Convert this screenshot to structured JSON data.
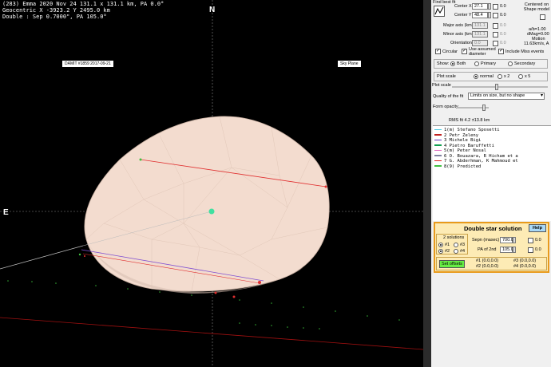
{
  "header": {
    "line1": "(283) Emma  2020 Nov 24  131.1 x 131.1 km, PA 0.0°",
    "line2": "Geocentric  X -3923.2  Y 2495.0 km",
    "line3": "Double : Sep 0.7000\", PA 105.0°"
  },
  "plot": {
    "model_tag": "DAMIT #1859 2017-09-21",
    "plane_tag": "Sky Plane",
    "north_label": "N",
    "east_label": "E"
  },
  "panel": {
    "find_best_fit": "Find best fit",
    "center_x_label": "Center X",
    "center_x_value": "27.1",
    "center_y_label": "Center Y",
    "center_y_value": "48.4",
    "centered_label": "Centered on Shape model",
    "major_axis_label": "Major axis (km)",
    "major_axis_value": "131.1",
    "minor_axis_label": "Minor axis (km)",
    "minor_axis_value": "131.1",
    "orientation_label": "Orientation",
    "orientation_value": "0.0",
    "ab_ratio": "a/b=1.00",
    "dmag": "dMag=0.00",
    "motion_label": "Motion",
    "motion_value": "11.63km/s, A",
    "zero_value": "0.0",
    "circular_label": "Circular",
    "use_assumed_label": "Use assumed diameter",
    "include_miss_label": "Include Miss events",
    "show_label": "Show:",
    "show_both": "Both",
    "show_primary": "Primary",
    "show_secondary": "Secondary",
    "plot_scale_label": "Plot scale",
    "scale_normal": "normal",
    "scale_x2": "x 2",
    "scale_x5": "x 5",
    "plot_scale_label2": "Plot scale",
    "quality_label": "Quality of the fit",
    "quality_value": "Limits on size, but no shape",
    "form_opacity_label": "Form opacity",
    "rms_fit": "RMS fit 4.2 ±13.8 km"
  },
  "observers": [
    {
      "text": "1(m) Stefano Sposetti",
      "color": "#4ec9e0"
    },
    {
      "text": "2    Petr Zeleny",
      "color": "#c02020"
    },
    {
      "text": "3    Michele Bigi",
      "color": "#6030c0"
    },
    {
      "text": "4    Pietro Baruffetti",
      "color": "#10a050"
    },
    {
      "text": "5(m) Peter Nosal",
      "color": "#e070c0"
    },
    {
      "text": "6    O. Bouazara, R Hicham et a",
      "color": "#8080a0"
    },
    {
      "text": "7    G. Abderhman, K Mahmoud et",
      "color": "#e02020"
    },
    {
      "text": "8(9) Predicted",
      "color": "#40c040"
    }
  ],
  "double_star": {
    "title": "Double star solution",
    "help": "Help",
    "solutions_label": "2 solutions",
    "sol1": "#1",
    "sol2": "#2",
    "sol3": "#3",
    "sol4": "#4",
    "sepn_label": "Sepn (masec)",
    "sepn_value": "700.0",
    "pa_label": "PA of 2nd",
    "pa_value": "105.0",
    "zero": "0.0",
    "set_offsets": "Set offsets",
    "off1": "#1 (0.0,0.0)",
    "off2": "#2 (0.0,0.0)",
    "off3": "#3 (0.0,0.0)",
    "off4": "#4 (0.0,0.0)"
  },
  "colors": {
    "shape_fill": "#f3dccf",
    "chord_red": "#e03030",
    "chord_purple": "#8050d0",
    "center_dot": "#40e0a0",
    "dss_border": "#e89a1c",
    "dss_bg": "#fdebb5",
    "set_offsets_bg": "#66ee44",
    "help_bg": "#a8d8f8"
  }
}
